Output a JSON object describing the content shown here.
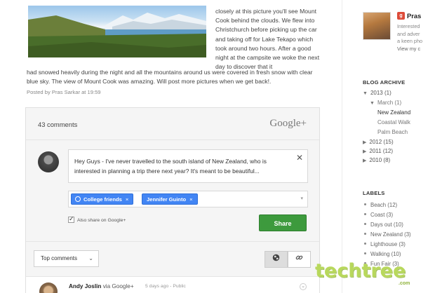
{
  "post": {
    "text_right": "closely at this picture you'll see Mount Cook behind the clouds. We flew into Christchurch before picking up the car and taking off for Lake Tekapo which took around two hours. After a good night at the campsite we woke the next day to discover that it",
    "text_full": "had snowed heavily during the night and all the mountains around us were covered in fresh snow with clear blue sky. The view of Mount Cook was amazing. Will post more pictures when we get back!.",
    "meta": "Posted by Pras Sarkar at 19:59"
  },
  "comments_box": {
    "count_label": "43 comments",
    "brand": "Google+",
    "composer_text": "Hey Guys - I've never travelled to the south island of New Zealand, who is interested in planning a trip there next year? It's meant to be beautiful...",
    "close_glyph": "✕",
    "chips": [
      {
        "label": "College friends",
        "remove": "×"
      },
      {
        "label": "Jennifer Guinto",
        "remove": "×"
      }
    ],
    "caret": "▾",
    "also_share_label": "Also share on Google+",
    "share_button": "Share",
    "sort_label": "Top comments",
    "sort_caret": "⌄"
  },
  "comment": {
    "author": "Andy Joslin",
    "via": "via Google+",
    "time": "5 days ago",
    "separator": "-",
    "visibility": "Public"
  },
  "sidebar": {
    "profile_name": "Pras",
    "profile_desc_lines": [
      "Interested",
      "and adver",
      "a keen pho"
    ],
    "profile_link": "View my c",
    "archive_heading": "BLOG ARCHIVE",
    "archive": [
      {
        "label": "2013 (1)",
        "tri": "▼"
      },
      {
        "label": "March (1)",
        "tri": "▼"
      },
      {
        "label": "New Zealand"
      },
      {
        "label": "Coastal Walk"
      },
      {
        "label": "Palm Beach"
      },
      {
        "label": "2012 (15)",
        "tri": "▶"
      },
      {
        "label": "2011 (12)",
        "tri": "▶"
      },
      {
        "label": "2010 (8)",
        "tri": "▶"
      }
    ],
    "labels_heading": "LABELS",
    "labels": [
      "Beach (12)",
      "Coast (3)",
      "Days out (10)",
      "New Zealand (3)",
      "Lighthouse (3)",
      "Walking (10)",
      "Fun Fair (3)"
    ]
  },
  "watermark": {
    "name": "techtree",
    "sub": ".com"
  },
  "colors": {
    "share_green": "#3d9a3d",
    "chip_blue": "#4285f4",
    "gplus_red": "#dd4b39"
  }
}
